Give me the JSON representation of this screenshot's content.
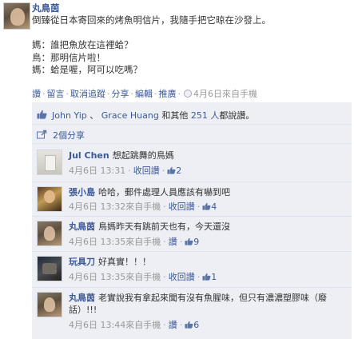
{
  "post": {
    "author": "丸鳥茵",
    "lines": [
      "倒臻從日本寄回來的烤魚明信片，我隨手把它晾在沙發上。",
      "",
      "媽：誰把魚放在這裡蛤？",
      "鳥：那明信片啦！",
      "媽：蛤是喔，阿可以吃嗎？"
    ],
    "actions": {
      "like": "讚",
      "comment": "留言",
      "unfollow": "取消追蹤",
      "share": "分享",
      "edit": "編輯",
      "promote": "推廣",
      "timestamp": "4月6日來自手機"
    }
  },
  "likes": {
    "user1": "John Yip",
    "sep": "、",
    "user2": "Grace Huang",
    "and": "和其他",
    "others": "251 人",
    "suffix": "都說讚。"
  },
  "shares_label": "2個分享",
  "comments": [
    {
      "name": "Jul Chen",
      "text": "想起跳舞的鳥媽",
      "time": "4月6日 13:31",
      "action": "收回讚",
      "likes": "2"
    },
    {
      "name": "張小島",
      "text": "哈哈，郵件處理人員應該有嚇到吧",
      "time": "4月6日 13:32來自手機",
      "action": "收回讚",
      "likes": "4"
    },
    {
      "name": "丸鳥茵",
      "text": "鳥媽昨天有跳前天也有，今天還沒",
      "time": "4月6日 13:35來自手機",
      "action": "讚",
      "likes": "9"
    },
    {
      "name": "玩具刀",
      "text": "好真實！！！",
      "time": "4月6日 13:35來自手機",
      "action": "收回讚",
      "likes": "1"
    },
    {
      "name": "丸鳥茵",
      "text": "老實說我有拿起來聞有沒有魚腥味，但只有濃濃塑膠味（廢話）!!!",
      "time": "4月6日 13:44來自手機",
      "action": "讚",
      "likes": "6"
    }
  ]
}
